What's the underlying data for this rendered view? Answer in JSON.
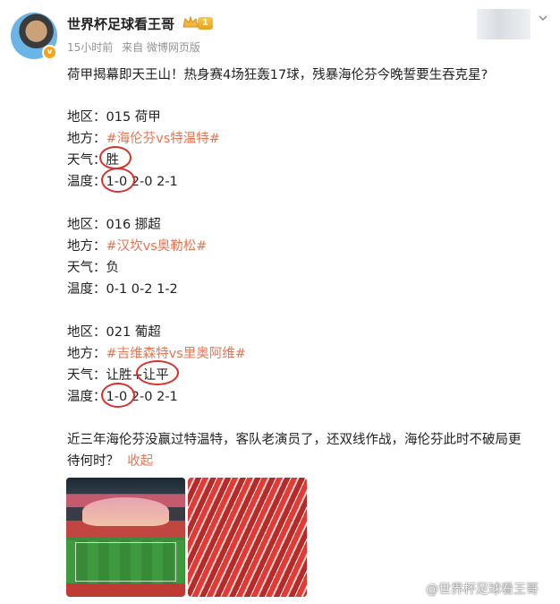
{
  "header": {
    "username": "世界杯足球看王哥",
    "vip_level": "1",
    "time": "15小时前",
    "source": "来自 微博网页版"
  },
  "post": {
    "title": "荷甲揭幕即天王山！热身赛4场狂轰17球，残暴海伦芬今晚誓要生吞克星?",
    "matches": [
      {
        "region_label": "地区：",
        "region_value": "015  荷甲",
        "place_label": "地方：",
        "place_value": "#海伦芬vs特温特#",
        "weather_label": "天气：",
        "weather_value": "胜",
        "temp_label": "温度：",
        "temp_first": "1-0",
        "temp_rest": "2-0  2-1"
      },
      {
        "region_label": "地区：",
        "region_value": "016  挪超",
        "place_label": "地方：",
        "place_value": "#汉坎vs奥勒松#",
        "weather_label": "天气：",
        "weather_value": "负",
        "temp_label": "温度：",
        "temp_first": "0-1",
        "temp_rest": "0-2  1-2"
      },
      {
        "region_label": "地区：",
        "region_value": "021  葡超",
        "place_label": "地方：",
        "place_value": "#吉维森特vs里奥阿维#",
        "weather_label": "天气：",
        "weather_value_a": "让胜",
        "weather_value_b": "让平",
        "temp_label": "温度：",
        "temp_first": "1-0",
        "temp_rest": "2-0  2-1"
      }
    ],
    "summary_line1": "近三年海伦芬没赢过特温特，客队老演员了，还双线作战，海伦芬此时不破局更",
    "summary_line2": "待何时？",
    "collapse_label": "收起"
  },
  "watermark": "@世界杯足球看王哥",
  "colors": {
    "accent": "#eb7350",
    "circle": "#d8312a",
    "meta_text": "#939393"
  },
  "icons": [
    "chevron-down-icon",
    "vip-crown-icon",
    "verified-badge-icon",
    "weibo-logo-icon"
  ]
}
